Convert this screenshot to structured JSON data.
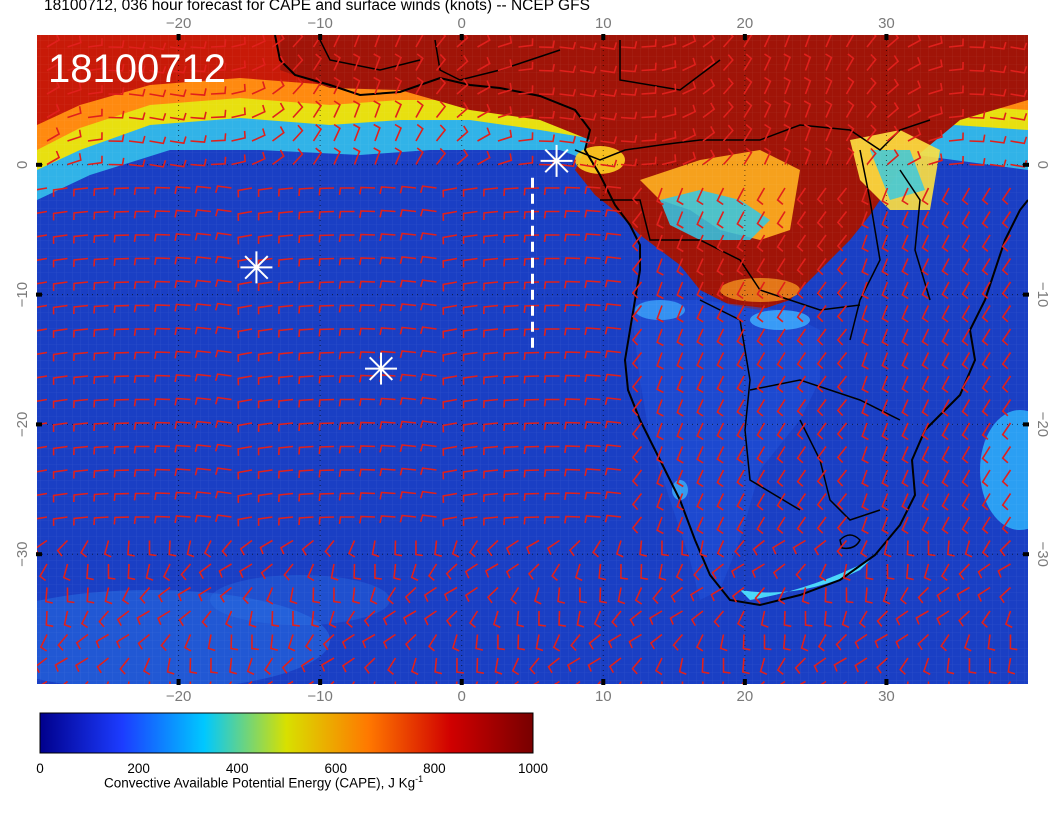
{
  "title": "18100712, 036 hour forecast for CAPE and surface winds (knots) -- NCEP GFS",
  "stamp": "18100712",
  "map": {
    "lon_range": [
      -30,
      40
    ],
    "lat_range": [
      -40,
      10
    ],
    "lon_ticks": [
      {
        "v": -20,
        "label": "−20"
      },
      {
        "v": -10,
        "label": "−10"
      },
      {
        "v": 0,
        "label": "0"
      },
      {
        "v": 10,
        "label": "10"
      },
      {
        "v": 20,
        "label": "20"
      },
      {
        "v": 30,
        "label": "30"
      }
    ],
    "lat_ticks": [
      {
        "v": 0,
        "label": "0"
      },
      {
        "v": -10,
        "label": "−10"
      },
      {
        "v": -20,
        "label": "−20"
      },
      {
        "v": -30,
        "label": "−30"
      }
    ],
    "markers": [
      {
        "lon": 6.7,
        "lat": 0.3
      },
      {
        "lon": -14.5,
        "lat": -7.9
      },
      {
        "lon": -5.7,
        "lat": -15.7
      }
    ],
    "dashed_line": {
      "lon": 5.0,
      "lat_start": -1.0,
      "lat_end": -14.5
    },
    "colors": {
      "ocean_low": "#1638b8",
      "land_high": "#9c1208",
      "wind_barb": "#e0201c",
      "coast": "#000000"
    }
  },
  "colorbar": {
    "label": "Convective Available Potential Energy (CAPE), J Kg",
    "label_sup": "-1",
    "ticks": [
      "0",
      "200",
      "400",
      "600",
      "800",
      "1000"
    ],
    "range": [
      0,
      1000
    ],
    "stops": [
      "#00008c",
      "#1c3cff",
      "#00c8ff",
      "#d8e000",
      "#ff7800",
      "#d00000",
      "#780000"
    ]
  }
}
